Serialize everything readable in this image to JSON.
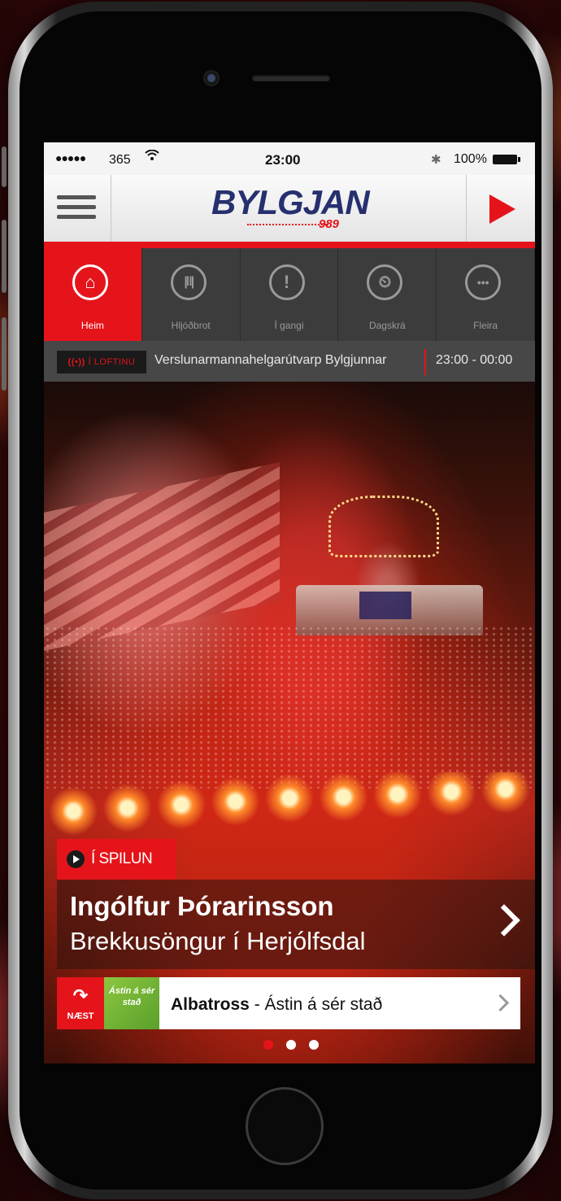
{
  "status_bar": {
    "signal": "●●●●●",
    "carrier": "365",
    "wifi_icon": "wifi-icon",
    "time": "23:00",
    "bluetooth_icon": "bluetooth-icon",
    "battery": "100%"
  },
  "header": {
    "logo": "BYLGJAN",
    "logo_sub": "989",
    "menu_icon": "hamburger-icon",
    "play_icon": "play-icon",
    "accent_color": "#e5141a",
    "logo_color": "#27306e"
  },
  "tabs": [
    {
      "label": "Heim",
      "icon": "home-icon",
      "active": true
    },
    {
      "label": "Hljóðbrot",
      "icon": "soundwave-icon",
      "active": false
    },
    {
      "label": "Í gangi",
      "icon": "exclamation-bubble-icon",
      "active": false
    },
    {
      "label": "Dagskrá",
      "icon": "clock-icon",
      "active": false
    },
    {
      "label": "Fleira",
      "icon": "more-icon",
      "active": false
    }
  ],
  "on_air": {
    "badge": "Í LOFTINU",
    "show": "Verslunarmannahelgarútvarp Bylgjunnar",
    "time_range": "23:00 - 00:00"
  },
  "now_playing": {
    "badge": "Í SPILUN",
    "artist": "Ingólfur Þórarinsson",
    "song": "Brekkusöngur í Herjólfsdal"
  },
  "next_up": {
    "tag": "NÆST",
    "artist": "Albatross",
    "separator": " - ",
    "song": "Ástin á sér stað",
    "album_art_text": "Ástin á sér stað"
  },
  "pager": {
    "count": 3,
    "active_index": 0
  }
}
